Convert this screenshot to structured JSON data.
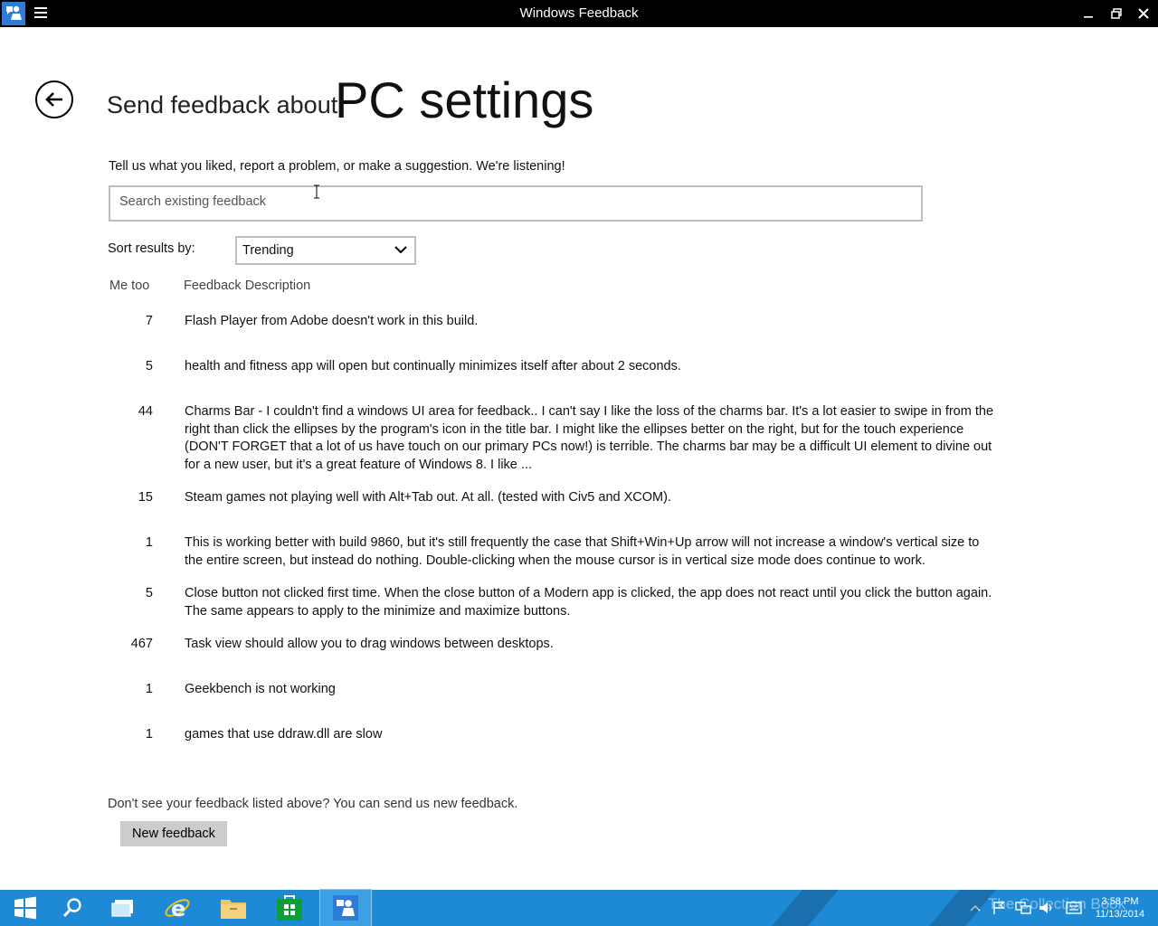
{
  "window": {
    "title": "Windows Feedback"
  },
  "header": {
    "send_label": "Send feedback about",
    "title": "PC settings"
  },
  "intro": "Tell us what you liked, report a problem, or make a suggestion. We're listening!",
  "search": {
    "placeholder": "Search existing feedback"
  },
  "sort": {
    "label": "Sort results by:",
    "selected": "Trending"
  },
  "columns": {
    "me_too": "Me too",
    "description": "Feedback Description"
  },
  "feedback": [
    {
      "count": "7",
      "text": "Flash Player from Adobe doesn't work in this build."
    },
    {
      "count": "5",
      "text": "health and fitness app will open but continually minimizes itself after about 2 seconds."
    },
    {
      "count": "44",
      "text": "Charms Bar - I couldn't find a windows UI area for feedback..  I can't say I like the loss of the charms bar.  It's a lot easier to swipe in from the right than click the ellipses by the program's icon in the title bar.  I might like the ellipses better on the right, but for the touch experience (DON'T FORGET that a lot of us have touch on our primary PCs now!) is terrible.  The charms bar may be a difficult UI element to divine out for a new user, but it's a great feature of Windows 8.  I like ..."
    },
    {
      "count": "15",
      "text": "Steam games not playing well with Alt+Tab out.   At all.  (tested with Civ5 and XCOM)."
    },
    {
      "count": "1",
      "text": "This is working better with build 9860, but it's still frequently the case that Shift+Win+Up arrow will not increase a window's vertical size to the entire screen, but instead do nothing. Double-clicking when the mouse cursor is in vertical size mode does continue to work."
    },
    {
      "count": "5",
      "text": "Close button not clicked first time.  When the close button of a Modern app is clicked, the app does not react until you click the button again.  The same appears to apply to the minimize and maximize buttons."
    },
    {
      "count": "467",
      "text": "Task view should allow you to drag windows between desktops."
    },
    {
      "count": "1",
      "text": "Geekbench is not working"
    },
    {
      "count": "1",
      "text": "games that use ddraw.dll are slow"
    }
  ],
  "footer": {
    "text": "Don't see your feedback listed above? You can send us new feedback.",
    "button": "New feedback"
  },
  "taskbar": {
    "watermark": "The Collection Book",
    "time": "3:58 PM",
    "date": "11/13/2014",
    "accent": "#1e8ad6"
  }
}
